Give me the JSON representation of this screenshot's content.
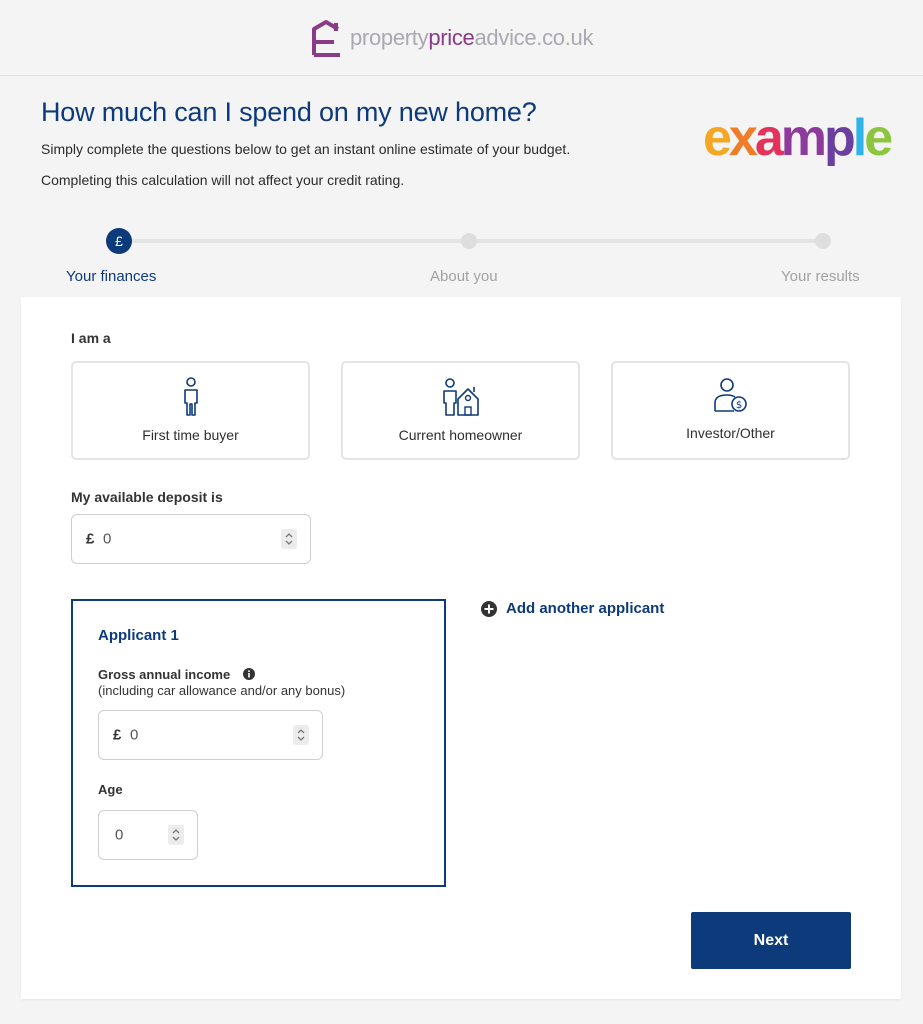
{
  "header": {
    "logo_parts": [
      "property",
      "price",
      "advice",
      ".co.uk"
    ]
  },
  "hero": {
    "title": "How much can I spend on my new home?",
    "subtitle_1": "Simply complete the questions below to get an instant online estimate of your budget.",
    "subtitle_2": "Completing this calculation will not affect your credit rating.",
    "brand_logo": "example",
    "brand_letters": [
      {
        "ch": "e",
        "color": "#f5a623"
      },
      {
        "ch": "x",
        "color": "#f07c28"
      },
      {
        "ch": "a",
        "color": "#e4335b"
      },
      {
        "ch": "m",
        "color": "#8e3a9d"
      },
      {
        "ch": "p",
        "color": "#6b3fa0"
      },
      {
        "ch": "l",
        "color": "#2fb3e8"
      },
      {
        "ch": "e",
        "color": "#8cc63f"
      }
    ]
  },
  "steps": [
    {
      "label": "Your finances",
      "icon": "£",
      "active": true
    },
    {
      "label": "About you",
      "active": false
    },
    {
      "label": "Your results",
      "active": false
    }
  ],
  "form": {
    "i_am_a_label": "I am a",
    "buyer_types": [
      {
        "label": "First time buyer",
        "icon": "person-icon"
      },
      {
        "label": "Current homeowner",
        "icon": "family-house-icon"
      },
      {
        "label": "Investor/Other",
        "icon": "investor-icon"
      }
    ],
    "deposit_label": "My available deposit is",
    "deposit": {
      "currency": "£",
      "value": "0"
    },
    "applicant": {
      "title": "Applicant 1",
      "gross_label": "Gross annual income",
      "gross_sub": "(including car allowance and/or any bonus)",
      "income": {
        "currency": "£",
        "value": "0"
      },
      "age_label": "Age",
      "age_value": "0"
    },
    "add_applicant": "Add another applicant",
    "next": "Next"
  },
  "colors": {
    "primary": "#0d3a7a",
    "logo_purple": "#8b3a86",
    "logo_grey": "#a9a9b3"
  }
}
